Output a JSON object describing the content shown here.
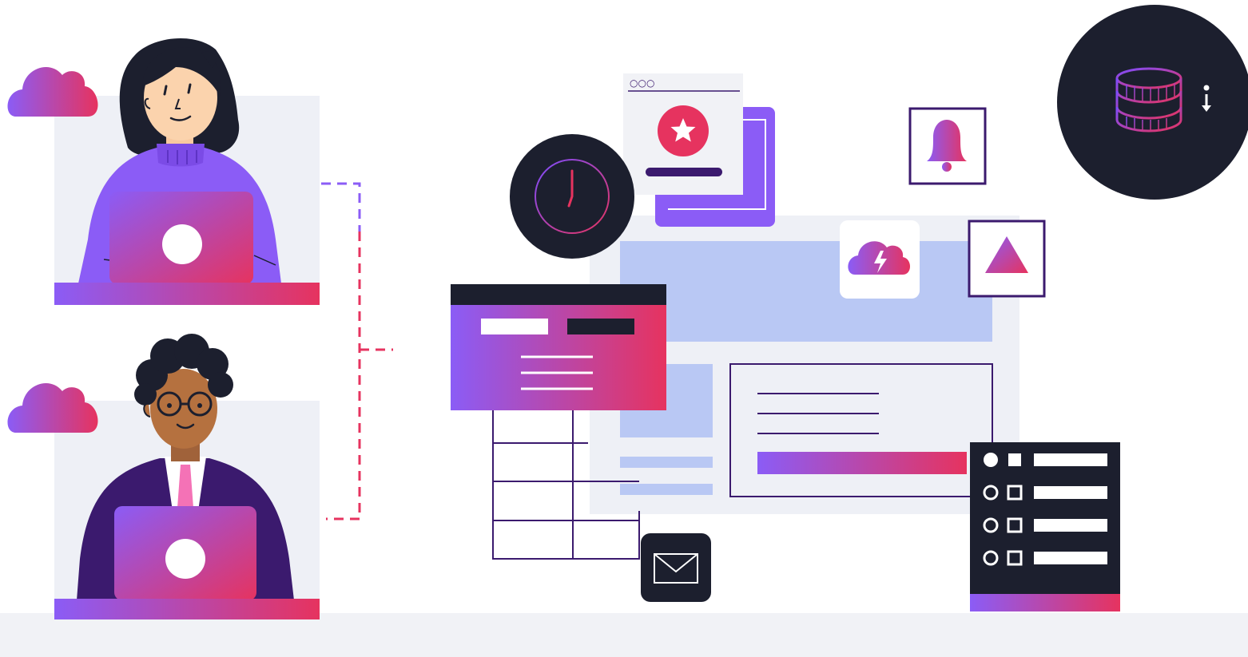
{
  "scene": {
    "browser_window_dots": "○○○",
    "icons": {
      "cloud_top": "cloud-icon",
      "cloud_bottom": "cloud-icon",
      "clock": "clock-icon",
      "star_badge": "star-icon",
      "bell": "bell-icon",
      "warning_triangle": "triangle-icon",
      "cloud_lightning": "cloud-lightning-icon",
      "coins_download": "coins-download-icon",
      "mail": "envelope-icon",
      "checklist": "checklist-icon"
    },
    "checklist": {
      "items": [
        {
          "radio_checked": true,
          "box_checked": true
        },
        {
          "radio_checked": false,
          "box_checked": false
        },
        {
          "radio_checked": false,
          "box_checked": false
        },
        {
          "radio_checked": false,
          "box_checked": false
        }
      ]
    }
  },
  "colors": {
    "purple": "#8b5cf6",
    "pink": "#e6335f",
    "navy": "#1c1f2e",
    "light_blue": "#b9c8f4",
    "panel_bg": "#eef0f6",
    "dark_purple": "#3b1a6e"
  }
}
